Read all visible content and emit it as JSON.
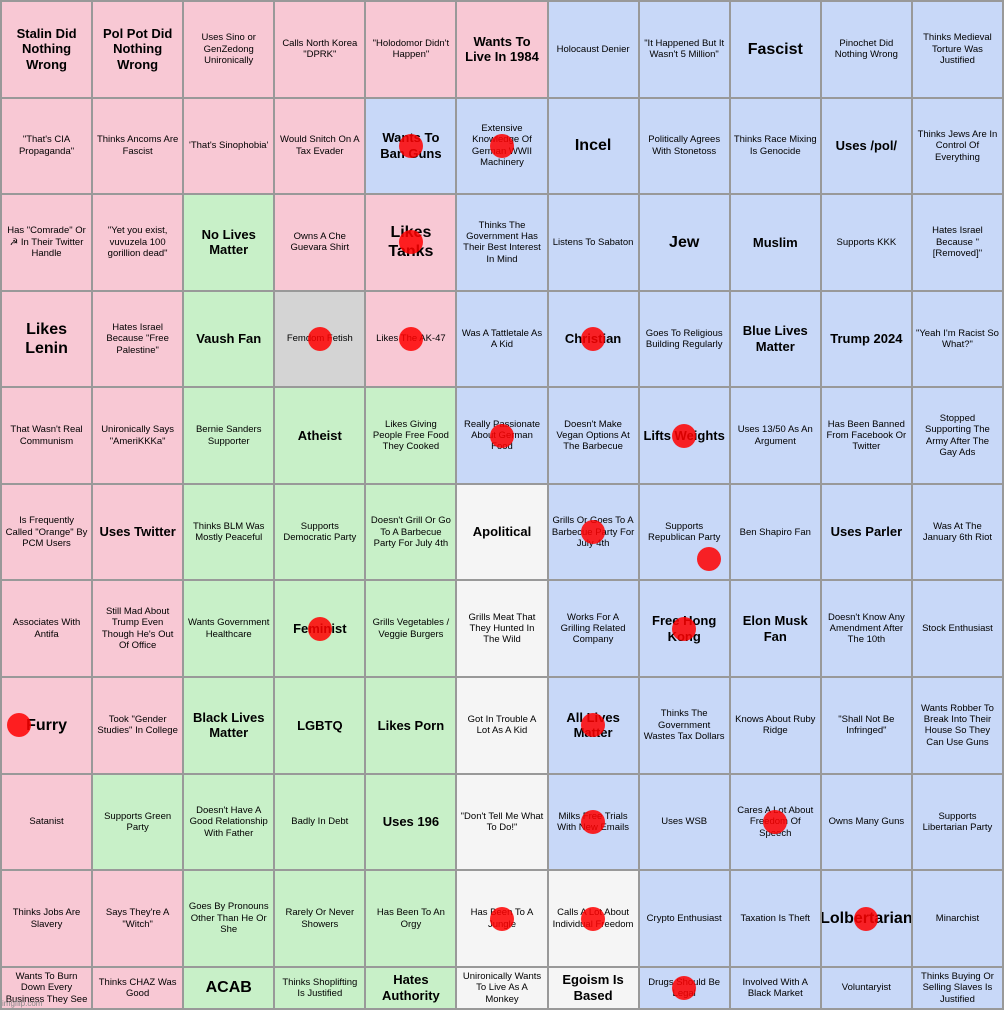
{
  "grid": {
    "cols": 11,
    "rows": 10,
    "cells": [
      {
        "id": "r0c0",
        "text": "Stalin Did Nothing Wrong",
        "color": "pink",
        "size": "large"
      },
      {
        "id": "r0c1",
        "text": "Pol Pot Did Nothing Wrong",
        "color": "pink",
        "size": "large"
      },
      {
        "id": "r0c2",
        "text": "Uses Sino or GenZedong Unironically",
        "color": "pink",
        "size": "normal"
      },
      {
        "id": "r0c3",
        "text": "Calls North Korea \"DPRK\"",
        "color": "pink",
        "size": "normal"
      },
      {
        "id": "r0c4",
        "text": "\"Holodomor Didn't Happen\"",
        "color": "pink",
        "size": "normal"
      },
      {
        "id": "r0c5",
        "text": "Wants To Live In 1984",
        "color": "pink",
        "size": "large"
      },
      {
        "id": "r0c6",
        "text": "Holocaust Denier",
        "color": "blue",
        "size": "normal"
      },
      {
        "id": "r0c7",
        "text": "\"It Happened But It Wasn't 5 Million\"",
        "color": "blue",
        "size": "normal"
      },
      {
        "id": "r0c8",
        "text": "Fascist",
        "color": "blue",
        "size": "xlarge"
      },
      {
        "id": "r0c9",
        "text": "Pinochet Did Nothing Wrong",
        "color": "blue",
        "size": "normal"
      },
      {
        "id": "r0c10",
        "text": "Thinks Medieval Torture Was Justified",
        "color": "blue",
        "size": "normal"
      },
      {
        "id": "r1c0",
        "text": "\"That's CIA Propaganda\"",
        "color": "pink",
        "size": "normal"
      },
      {
        "id": "r1c1",
        "text": "Thinks Ancoms Are Fascist",
        "color": "pink",
        "size": "normal"
      },
      {
        "id": "r1c2",
        "text": "'That's Sinophobia'",
        "color": "pink",
        "size": "normal"
      },
      {
        "id": "r1c3",
        "text": "Would Snitch On A Tax Evader",
        "color": "pink",
        "size": "normal"
      },
      {
        "id": "r1c4",
        "text": "Wants To Ban Guns",
        "color": "blue",
        "size": "large",
        "dot": "center"
      },
      {
        "id": "r1c5",
        "text": "Extensive Knowledge Of German WWII Machinery",
        "color": "blue",
        "size": "normal",
        "dot": "center"
      },
      {
        "id": "r1c6",
        "text": "Incel",
        "color": "blue",
        "size": "xlarge"
      },
      {
        "id": "r1c7",
        "text": "Politically Agrees With Stonetoss",
        "color": "blue",
        "size": "normal"
      },
      {
        "id": "r1c8",
        "text": "Thinks Race Mixing Is Genocide",
        "color": "blue",
        "size": "normal"
      },
      {
        "id": "r1c9",
        "text": "Uses /pol/",
        "color": "blue",
        "size": "large"
      },
      {
        "id": "r1c10",
        "text": "Thinks Jews Are In Control Of Everything",
        "color": "blue",
        "size": "normal"
      },
      {
        "id": "r2c0",
        "text": "Has \"Comrade\" Or ☭ In Their Twitter Handle",
        "color": "pink",
        "size": "normal"
      },
      {
        "id": "r2c1",
        "text": "\"Yet you exist, vuvuzela 100 gorillion dead\"",
        "color": "pink",
        "size": "normal"
      },
      {
        "id": "r2c2",
        "text": "No Lives Matter",
        "color": "green",
        "size": "large"
      },
      {
        "id": "r2c3",
        "text": "Owns A Che Guevara Shirt",
        "color": "pink",
        "size": "normal"
      },
      {
        "id": "r2c4",
        "text": "Likes Tanks",
        "color": "pink",
        "size": "xlarge",
        "dot": "center"
      },
      {
        "id": "r2c5",
        "text": "Thinks The Government Has Their Best Interest In Mind",
        "color": "blue",
        "size": "normal"
      },
      {
        "id": "r2c6",
        "text": "Listens To Sabaton",
        "color": "blue",
        "size": "normal"
      },
      {
        "id": "r2c7",
        "text": "Jew",
        "color": "blue",
        "size": "xlarge"
      },
      {
        "id": "r2c8",
        "text": "Muslim",
        "color": "blue",
        "size": "large"
      },
      {
        "id": "r2c9",
        "text": "Supports KKK",
        "color": "blue",
        "size": "normal"
      },
      {
        "id": "r2c10",
        "text": "Hates Israel Because \"[Removed]\"",
        "color": "blue",
        "size": "normal"
      },
      {
        "id": "r3c0",
        "text": "Likes Lenin",
        "color": "pink",
        "size": "xlarge"
      },
      {
        "id": "r3c1",
        "text": "Hates Israel Because \"Free Palestine\"",
        "color": "pink",
        "size": "normal"
      },
      {
        "id": "r3c2",
        "text": "Vaush Fan",
        "color": "green",
        "size": "large"
      },
      {
        "id": "r3c3",
        "text": "Femdom Fetish",
        "color": "lgray",
        "size": "normal",
        "dot": "center"
      },
      {
        "id": "r3c4",
        "text": "Likes The AK-47",
        "color": "pink",
        "size": "normal",
        "dot": "center"
      },
      {
        "id": "r3c5",
        "text": "Was A Tattletale As A Kid",
        "color": "blue",
        "size": "normal"
      },
      {
        "id": "r3c6",
        "text": "Christian",
        "color": "blue",
        "size": "large",
        "dot": "center"
      },
      {
        "id": "r3c7",
        "text": "Goes To Religious Building Regularly",
        "color": "blue",
        "size": "normal"
      },
      {
        "id": "r3c8",
        "text": "Blue Lives Matter",
        "color": "blue",
        "size": "large"
      },
      {
        "id": "r3c9",
        "text": "Trump 2024",
        "color": "blue",
        "size": "large"
      },
      {
        "id": "r3c10",
        "text": "\"Yeah I'm Racist So What?\"",
        "color": "blue",
        "size": "normal"
      },
      {
        "id": "r4c0",
        "text": "That Wasn't Real Communism",
        "color": "pink",
        "size": "normal"
      },
      {
        "id": "r4c1",
        "text": "Unironically Says \"AmeriKKKa\"",
        "color": "pink",
        "size": "normal"
      },
      {
        "id": "r4c2",
        "text": "Bernie Sanders Supporter",
        "color": "green",
        "size": "normal"
      },
      {
        "id": "r4c3",
        "text": "Atheist",
        "color": "green",
        "size": "large"
      },
      {
        "id": "r4c4",
        "text": "Likes Giving People Free Food They Cooked",
        "color": "green",
        "size": "normal"
      },
      {
        "id": "r4c5",
        "text": "Really Passionate About German Food",
        "color": "blue",
        "size": "normal",
        "dot": "center"
      },
      {
        "id": "r4c6",
        "text": "Doesn't Make Vegan Options At The Barbecue",
        "color": "blue",
        "size": "normal"
      },
      {
        "id": "r4c7",
        "text": "Lifts Weights",
        "color": "blue",
        "size": "large",
        "dot": "center"
      },
      {
        "id": "r4c8",
        "text": "Uses 13/50 As An Argument",
        "color": "blue",
        "size": "normal"
      },
      {
        "id": "r4c9",
        "text": "Has Been Banned From Facebook Or Twitter",
        "color": "blue",
        "size": "normal"
      },
      {
        "id": "r4c10",
        "text": "Stopped Supporting The Army After The Gay Ads",
        "color": "blue",
        "size": "normal"
      },
      {
        "id": "r5c0",
        "text": "Is Frequently Called \"Orange\" By PCM Users",
        "color": "pink",
        "size": "normal"
      },
      {
        "id": "r5c1",
        "text": "Uses Twitter",
        "color": "pink",
        "size": "large"
      },
      {
        "id": "r5c2",
        "text": "Thinks BLM Was Mostly Peaceful",
        "color": "green",
        "size": "normal"
      },
      {
        "id": "r5c3",
        "text": "Supports Democratic Party",
        "color": "green",
        "size": "normal"
      },
      {
        "id": "r5c4",
        "text": "Doesn't Grill Or Go To A Barbecue Party For July 4th",
        "color": "green",
        "size": "normal"
      },
      {
        "id": "r5c5",
        "text": "Apolitical",
        "color": "white",
        "size": "large"
      },
      {
        "id": "r5c6",
        "text": "Grills Or Goes To A Barbecue Party For July 4th",
        "color": "blue",
        "size": "normal",
        "dot": "center"
      },
      {
        "id": "r5c7",
        "text": "Supports Republican Party",
        "color": "blue",
        "size": "normal",
        "dot": "center"
      },
      {
        "id": "r5c8",
        "text": "Ben Shapiro Fan",
        "color": "blue",
        "size": "normal"
      },
      {
        "id": "r5c9",
        "text": "Uses Parler",
        "color": "blue",
        "size": "large"
      },
      {
        "id": "r5c10",
        "text": "Was At The January 6th Riot",
        "color": "blue",
        "size": "normal"
      },
      {
        "id": "r6c0",
        "text": "Associates With Antifa",
        "color": "pink",
        "size": "normal"
      },
      {
        "id": "r6c1",
        "text": "Still Mad About Trump Even Though He's Out Of Office",
        "color": "pink",
        "size": "normal"
      },
      {
        "id": "r6c2",
        "text": "Wants Government Healthcare",
        "color": "green",
        "size": "normal"
      },
      {
        "id": "r6c3",
        "text": "Feminist",
        "color": "green",
        "size": "large",
        "dot": "center"
      },
      {
        "id": "r6c4",
        "text": "Grills Vegetables / Veggie Burgers",
        "color": "green",
        "size": "normal"
      },
      {
        "id": "r6c5",
        "text": "Grills Meat That They Hunted In The Wild",
        "color": "white",
        "size": "normal"
      },
      {
        "id": "r6c6",
        "text": "Works For A Grilling Related Company",
        "color": "blue",
        "size": "normal"
      },
      {
        "id": "r6c7",
        "text": "Free Hong Kong",
        "color": "blue",
        "size": "large",
        "dot": "center"
      },
      {
        "id": "r6c8",
        "text": "Elon Musk Fan",
        "color": "blue",
        "size": "large"
      },
      {
        "id": "r6c9",
        "text": "Doesn't Know Any Amendment After The 10th",
        "color": "blue",
        "size": "normal"
      },
      {
        "id": "r6c10",
        "text": "Stock Enthusiast",
        "color": "blue",
        "size": "normal"
      },
      {
        "id": "r7c0",
        "text": "Furry",
        "color": "pink",
        "size": "xlarge",
        "dot": "mid-left"
      },
      {
        "id": "r7c1",
        "text": "Took \"Gender Studies\" In College",
        "color": "pink",
        "size": "normal"
      },
      {
        "id": "r7c2",
        "text": "Black Lives Matter",
        "color": "green",
        "size": "large"
      },
      {
        "id": "r7c3",
        "text": "LGBTQ",
        "color": "green",
        "size": "large"
      },
      {
        "id": "r7c4",
        "text": "Likes Porn",
        "color": "green",
        "size": "large"
      },
      {
        "id": "r7c5",
        "text": "Got In Trouble A Lot As A Kid",
        "color": "white",
        "size": "normal"
      },
      {
        "id": "r7c6",
        "text": "All Lives Matter",
        "color": "blue",
        "size": "large",
        "dot": "center"
      },
      {
        "id": "r7c7",
        "text": "Thinks The Government Wastes Tax Dollars",
        "color": "blue",
        "size": "normal"
      },
      {
        "id": "r7c8",
        "text": "Knows About Ruby Ridge",
        "color": "blue",
        "size": "normal"
      },
      {
        "id": "r7c9",
        "text": "\"Shall Not Be Infringed\"",
        "color": "blue",
        "size": "normal"
      },
      {
        "id": "r7c10",
        "text": "Wants Robber To Break Into Their House So They Can Use Guns",
        "color": "blue",
        "size": "normal"
      },
      {
        "id": "r8c0",
        "text": "Satanist",
        "color": "pink",
        "size": "normal"
      },
      {
        "id": "r8c1",
        "text": "Supports Green Party",
        "color": "green",
        "size": "normal"
      },
      {
        "id": "r8c2",
        "text": "Doesn't Have A Good Relationship With Father",
        "color": "green",
        "size": "normal"
      },
      {
        "id": "r8c3",
        "text": "Badly In Debt",
        "color": "green",
        "size": "normal"
      },
      {
        "id": "r8c4",
        "text": "Uses 196",
        "color": "green",
        "size": "large"
      },
      {
        "id": "r8c5",
        "text": "\"Don't Tell Me What To Do!\"",
        "color": "white",
        "size": "normal"
      },
      {
        "id": "r8c6",
        "text": "Milks Free Trials With New Emails",
        "color": "blue",
        "size": "normal",
        "dot": "center"
      },
      {
        "id": "r8c7",
        "text": "Uses WSB",
        "color": "blue",
        "size": "normal"
      },
      {
        "id": "r8c8",
        "text": "Cares A Lot About Freedom Of Speech",
        "color": "blue",
        "size": "normal",
        "dot": "center"
      },
      {
        "id": "r8c9",
        "text": "Owns Many Guns",
        "color": "blue",
        "size": "normal"
      },
      {
        "id": "r8c10",
        "text": "Supports Libertarian Party",
        "color": "blue",
        "size": "normal"
      },
      {
        "id": "r9c0",
        "text": "Thinks Jobs Are Slavery",
        "color": "pink",
        "size": "normal"
      },
      {
        "id": "r9c1",
        "text": "Says They're A \"Witch\"",
        "color": "pink",
        "size": "normal"
      },
      {
        "id": "r9c2",
        "text": "Goes By Pronouns Other Than He Or She",
        "color": "green",
        "size": "normal"
      },
      {
        "id": "r9c3",
        "text": "Rarely Or Never Showers",
        "color": "green",
        "size": "normal"
      },
      {
        "id": "r9c4",
        "text": "Has Been To An Orgy",
        "color": "green",
        "size": "normal"
      },
      {
        "id": "r9c5",
        "text": "Has Been To A Jungle",
        "color": "white",
        "size": "normal",
        "dot": "center"
      },
      {
        "id": "r9c6",
        "text": "Calls A Lot About Individual Freedom",
        "color": "white",
        "size": "normal",
        "dot": "center"
      },
      {
        "id": "r9c7",
        "text": "Crypto Enthusiast",
        "color": "blue",
        "size": "normal"
      },
      {
        "id": "r9c8",
        "text": "Taxation Is Theft",
        "color": "blue",
        "size": "normal"
      },
      {
        "id": "r9c9",
        "text": "Lolbertarian",
        "color": "blue",
        "size": "xlarge",
        "dot": "center"
      },
      {
        "id": "r9c10",
        "text": "Minarchist",
        "color": "blue",
        "size": "normal"
      },
      {
        "id": "r10c0",
        "text": "Wants To Burn Down Every Business They See",
        "color": "pink",
        "size": "normal"
      },
      {
        "id": "r10c1",
        "text": "Thinks CHAZ Was Good",
        "color": "pink",
        "size": "normal"
      },
      {
        "id": "r10c2",
        "text": "ACAB",
        "color": "green",
        "size": "xlarge"
      },
      {
        "id": "r10c3",
        "text": "Thinks Shoplifting Is Justified",
        "color": "green",
        "size": "normal"
      },
      {
        "id": "r10c4",
        "text": "Hates Authority",
        "color": "green",
        "size": "large"
      },
      {
        "id": "r10c5",
        "text": "Unironically Wants To Live As A Monkey",
        "color": "white",
        "size": "normal"
      },
      {
        "id": "r10c6",
        "text": "Egoism Is Based",
        "color": "white",
        "size": "large"
      },
      {
        "id": "r10c7",
        "text": "Drugs Should Be Legal",
        "color": "blue",
        "size": "normal",
        "dot": "center"
      },
      {
        "id": "r10c8",
        "text": "Involved With A Black Market",
        "color": "blue",
        "size": "normal"
      },
      {
        "id": "r10c9",
        "text": "Voluntaryist",
        "color": "blue",
        "size": "normal"
      },
      {
        "id": "r10c10",
        "text": "Thinks Buying Or Selling Slaves Is Justified",
        "color": "blue",
        "size": "normal"
      }
    ]
  }
}
